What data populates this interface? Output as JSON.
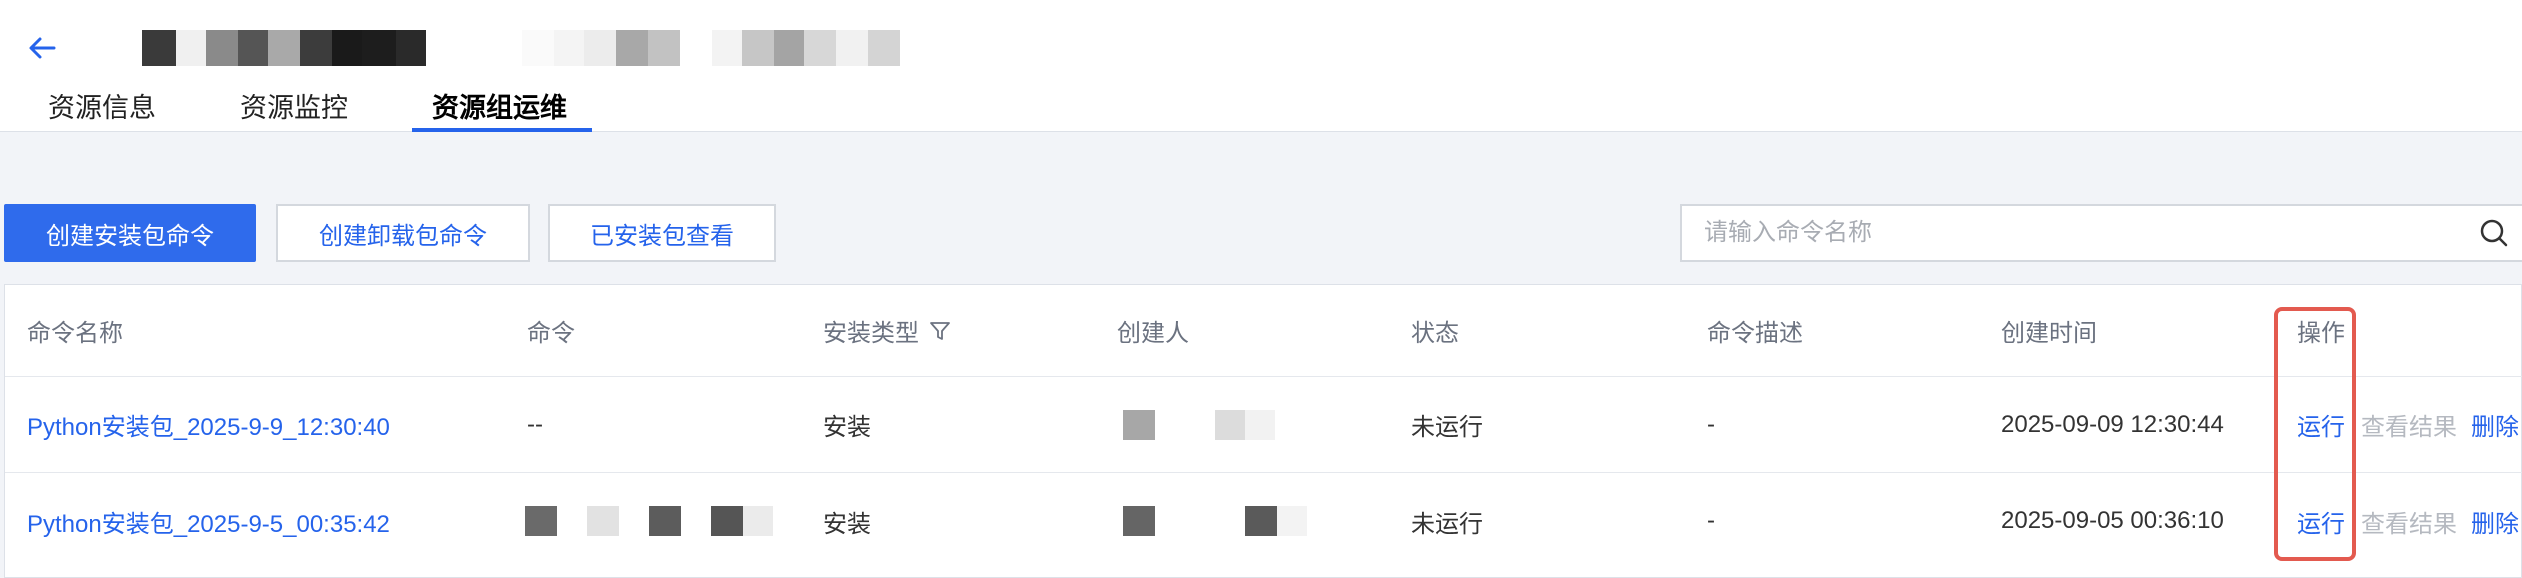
{
  "header": {
    "back_icon": "arrow-left-icon",
    "accent_color": "#2563eb",
    "tabs": [
      {
        "label": "资源信息",
        "active": false
      },
      {
        "label": "资源监控",
        "active": false
      },
      {
        "label": "资源组运维",
        "active": true
      }
    ]
  },
  "toolbar": {
    "create_install_label": "创建安装包命令",
    "create_uninstall_label": "创建卸载包命令",
    "view_installed_label": "已安装包查看",
    "search_placeholder": "请输入命令名称",
    "search_icon": "search-icon"
  },
  "table": {
    "columns": [
      "命令名称",
      "命令",
      "安装类型",
      "创建人",
      "状态",
      "命令描述",
      "创建时间",
      "操作"
    ],
    "filter_icon": "filter-icon",
    "rows": [
      {
        "name": "Python安装包_2025-9-9_12:30:40",
        "command": "--",
        "install_type": "安装",
        "status": "未运行",
        "description": "-",
        "created_at": "2025-09-09 12:30:44",
        "actions": {
          "run": "运行",
          "view_result": "查看结果",
          "delete": "删除"
        }
      },
      {
        "name": "Python安装包_2025-9-5_00:35:42",
        "command": "",
        "install_type": "安装",
        "status": "未运行",
        "description": "-",
        "created_at": "2025-09-05 00:36:10",
        "actions": {
          "run": "运行",
          "view_result": "查看结果",
          "delete": "删除"
        }
      }
    ]
  },
  "highlight_color": "#e35a4f"
}
